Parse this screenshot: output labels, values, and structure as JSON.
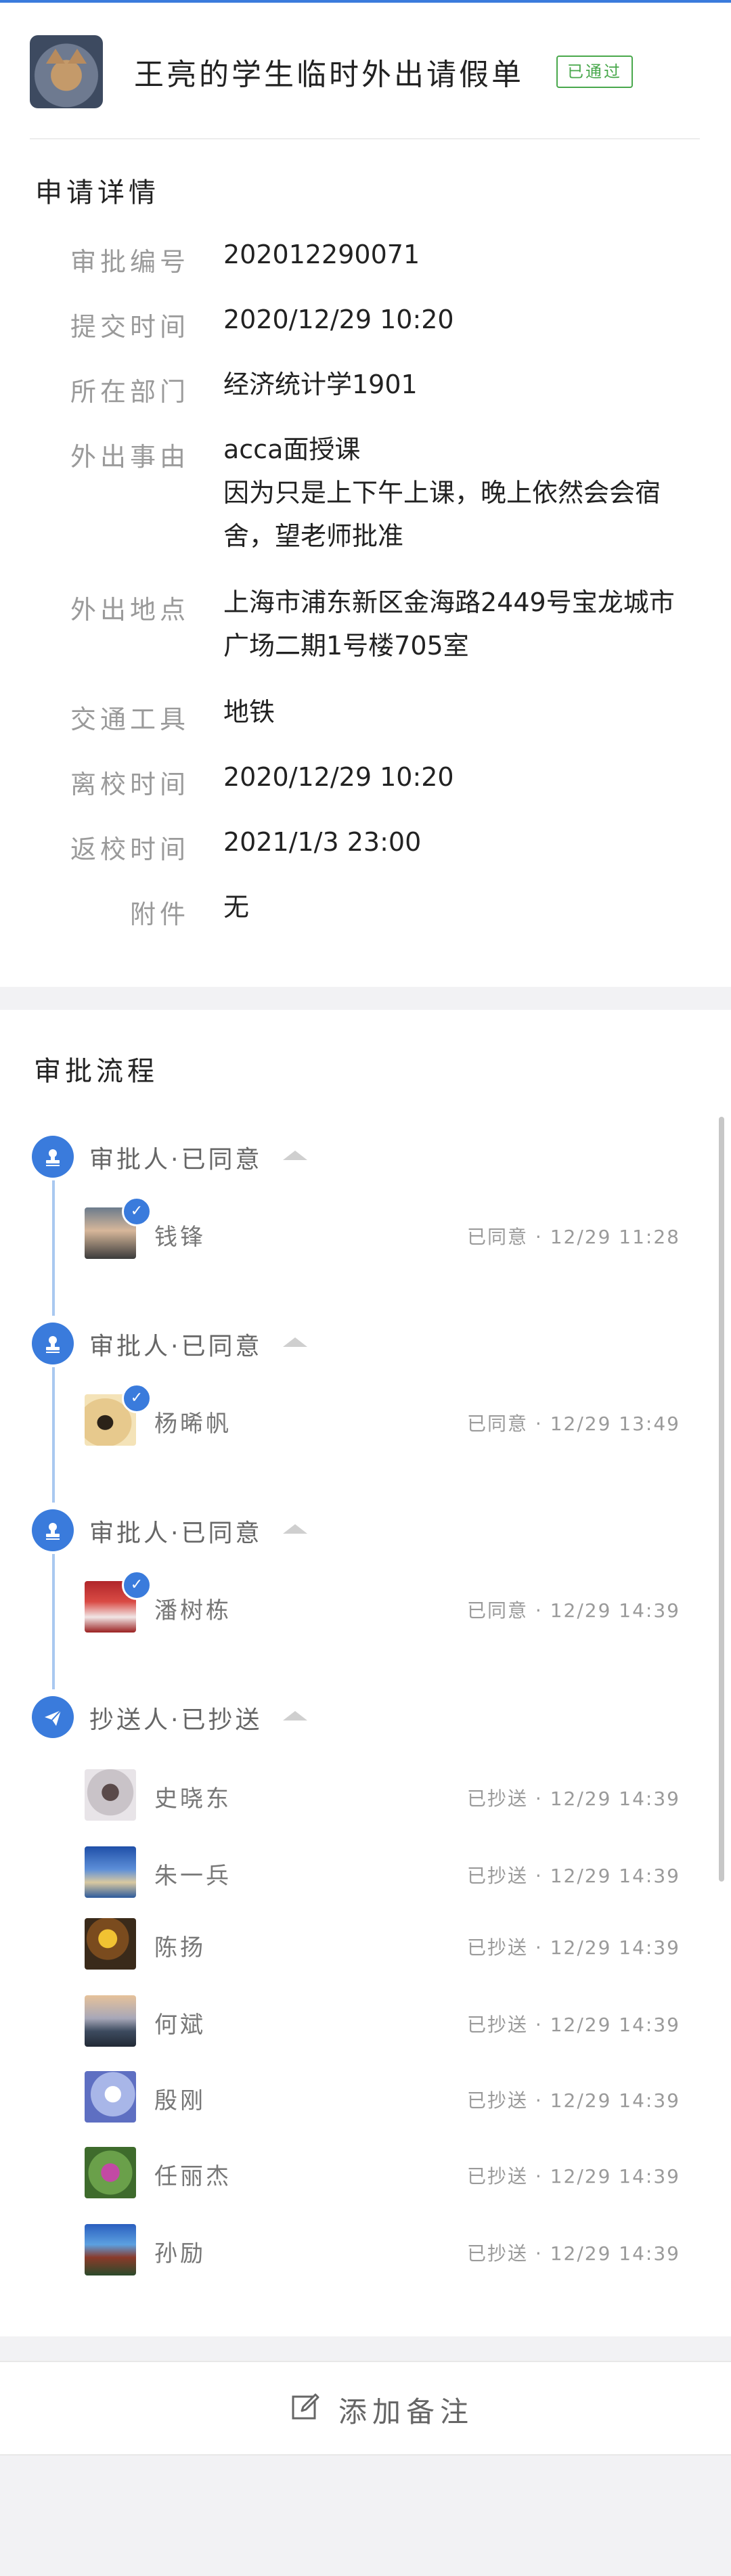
{
  "header": {
    "title": "王亮的学生临时外出请假单",
    "status_badge": "已通过",
    "avatar_icon": "cat-avatar"
  },
  "details": {
    "section_title": "申请详情",
    "rows": [
      {
        "label": "审批编号",
        "value": "202012290071"
      },
      {
        "label": "提交时间",
        "value": "2020/12/29 10:20"
      },
      {
        "label": "所在部门",
        "value": "经济统计学1901"
      },
      {
        "label": "外出事由",
        "value": "acca面授课\n因为只是上下午上课，晚上依然会会宿舍，望老师批准"
      },
      {
        "label": "外出地点",
        "value": "上海市浦东新区金海路2449号宝龙城市广场二期1号楼705室"
      },
      {
        "label": "交通工具",
        "value": "地铁"
      },
      {
        "label": "离校时间",
        "value": "2020/12/29 10:20"
      },
      {
        "label": "返校时间",
        "value": "2021/1/3 23:00"
      },
      {
        "label": "附件",
        "value": "无"
      }
    ]
  },
  "flow": {
    "section_title": "审批流程",
    "steps": [
      {
        "label": "审批人·已同意",
        "icon": "stamp-icon",
        "person": {
          "name": "钱锋",
          "status": "已同意 · 12/29 11:28"
        }
      },
      {
        "label": "审批人·已同意",
        "icon": "stamp-icon",
        "person": {
          "name": "杨晞帆",
          "status": "已同意 · 12/29 13:49"
        }
      },
      {
        "label": "审批人·已同意",
        "icon": "stamp-icon",
        "person": {
          "name": "潘树栋",
          "status": "已同意 · 12/29 14:39"
        }
      },
      {
        "label": "抄送人·已抄送",
        "icon": "send-icon"
      }
    ],
    "cc": [
      {
        "name": "史晓东",
        "status": "已抄送 · 12/29 14:39"
      },
      {
        "name": "朱一兵",
        "status": "已抄送 · 12/29 14:39"
      },
      {
        "name": "陈扬",
        "status": "已抄送 · 12/29 14:39"
      },
      {
        "name": "何斌",
        "status": "已抄送 · 12/29 14:39"
      },
      {
        "name": "殷刚",
        "status": "已抄送 · 12/29 14:39"
      },
      {
        "name": "任丽杰",
        "status": "已抄送 · 12/29 14:39"
      },
      {
        "name": "孙励",
        "status": "已抄送 · 12/29 14:39"
      }
    ]
  },
  "footer": {
    "add_note_label": "添加备注",
    "icon": "edit-icon"
  },
  "colors": {
    "accent": "#3a7bdc",
    "approved_green": "#49a84c",
    "timeline": "#a9c8f0"
  }
}
